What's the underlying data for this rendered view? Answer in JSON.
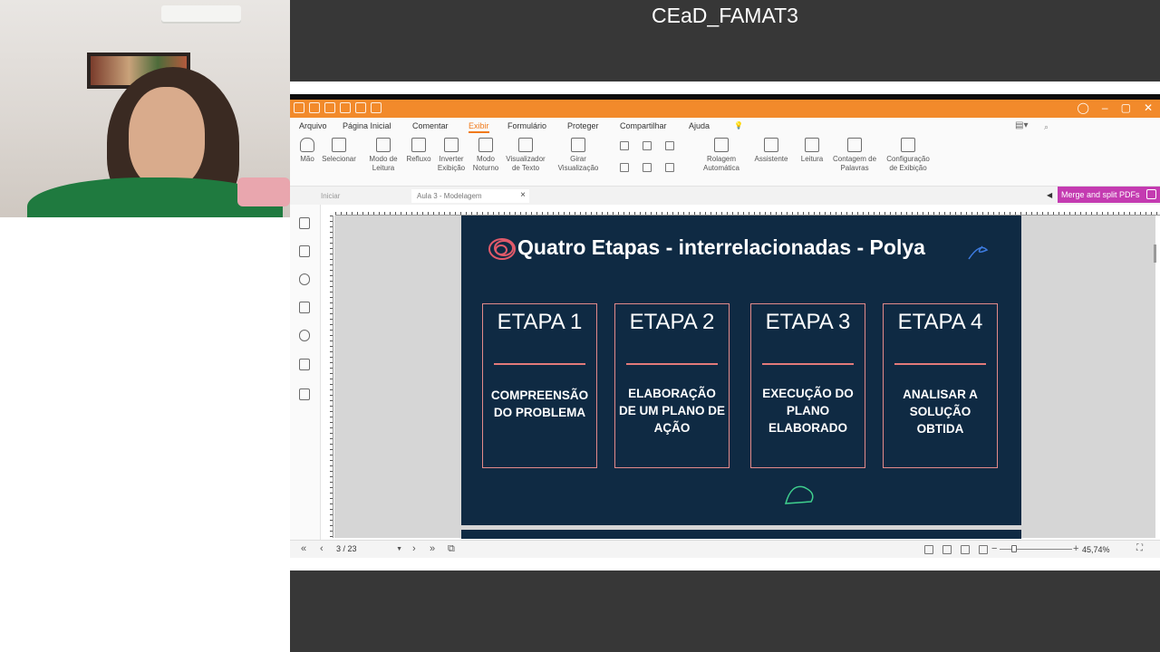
{
  "session": {
    "title": "CEaD_FAMAT3"
  },
  "app": {
    "menu": [
      "Arquivo",
      "Página Inicial",
      "Comentar",
      "Exibir",
      "Formulário",
      "Proteger",
      "Compartilhar",
      "Ajuda"
    ],
    "active_menu": "Exibir",
    "tools": [
      {
        "label": "Mão",
        "icon": "hand-icon"
      },
      {
        "label": "Selecionar",
        "icon": "select-text-icon"
      },
      {
        "label": "Modo de Leitura",
        "icon": "reading-mode-icon"
      },
      {
        "label": "Refluxo",
        "icon": "reflow-icon"
      },
      {
        "label": "Inverter Exibição",
        "icon": "invert-view-icon"
      },
      {
        "label": "Modo Noturno",
        "icon": "night-mode-icon"
      },
      {
        "label": "Visualizador de Texto",
        "icon": "text-viewer-icon"
      },
      {
        "label": "Girar Visualização",
        "icon": "rotate-view-icon"
      },
      {
        "label": "Rolagem Automática",
        "icon": "auto-scroll-icon"
      },
      {
        "label": "Assistente",
        "icon": "assistant-icon"
      },
      {
        "label": "Leitura",
        "icon": "read-aloud-icon"
      },
      {
        "label": "Contagem de Palavras",
        "icon": "word-count-icon"
      },
      {
        "label": "Configuração de Exibição",
        "icon": "display-settings-icon"
      }
    ],
    "tabs": {
      "home": "Iniciar",
      "document": "Aula 3 - Modelagem"
    },
    "merge_button": "Merge and split PDFs",
    "status": {
      "page": "3 / 23",
      "zoom": "45,74%",
      "zoom_fraction": 0.2
    }
  },
  "slide": {
    "title": "Quatro Etapas - interrelacionadas - Polya",
    "cards": [
      {
        "head": "ETAPA 1",
        "body": "COMPREENSÃO DO PROBLEMA"
      },
      {
        "head": "ETAPA 2",
        "body": "ELABORAÇÃO DE UM PLANO DE AÇÃO"
      },
      {
        "head": "ETAPA 3",
        "body": "EXECUÇÃO DO PLANO ELABORADO"
      },
      {
        "head": "ETAPA 4",
        "body": "ANALISAR A SOLUÇÃO OBTIDA"
      }
    ],
    "colors": {
      "background": "#0f2a43",
      "accent": "#e27a7a"
    }
  }
}
